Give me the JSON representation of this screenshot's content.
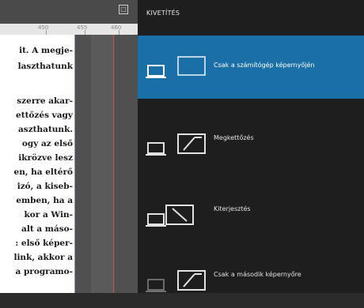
{
  "document": {
    "close_glyph": "□",
    "ruler_ticks": [
      "450",
      "455",
      "460"
    ],
    "lines": [
      "it. A megje-",
      "laszthatunk",
      "",
      "szerre akar-",
      "ettőzés vagy",
      "aszthatunk.",
      "ogy az első",
      "ikrözve lesz",
      "en, ha eltérő",
      "izó, a kiseb-",
      "emben, ha a",
      "kor a Win-",
      "alt a máso-",
      ": első képer-",
      "link, akkor a",
      "a programo-"
    ]
  },
  "panel": {
    "title": "KIVETÍTÉS",
    "options": [
      {
        "label": "Csak a számítógép képernyőjén",
        "icon": "pc-screen-only-icon",
        "selected": true
      },
      {
        "label": "Megkettőzés",
        "icon": "duplicate-icon",
        "selected": false
      },
      {
        "label": "Kiterjesztés",
        "icon": "extend-icon",
        "selected": false
      },
      {
        "label": "Csak a második képernyőre",
        "icon": "second-screen-only-icon",
        "selected": false
      }
    ]
  },
  "colors": {
    "accent": "#1a6fa6",
    "panel_bg": "#1e1e1e",
    "text": "#e2e2e2"
  }
}
